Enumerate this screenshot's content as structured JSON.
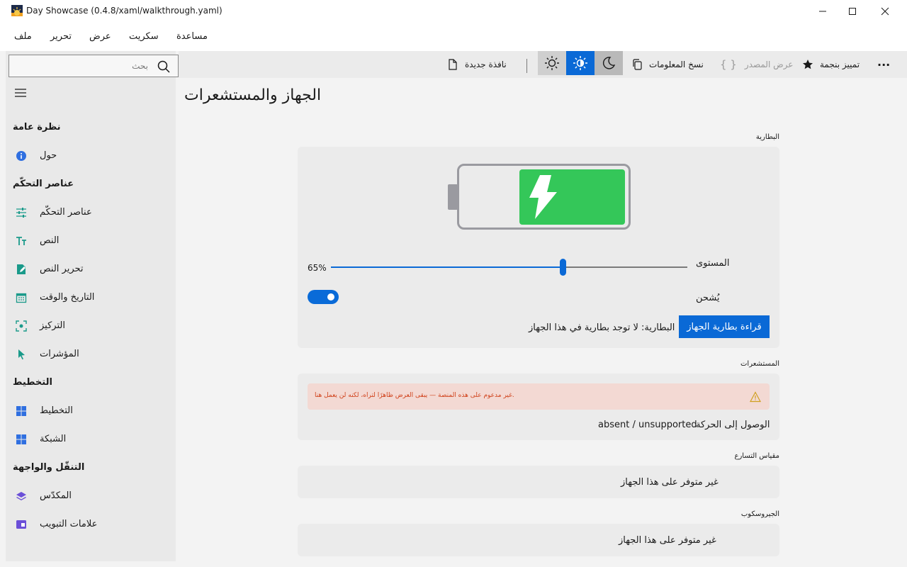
{
  "window": {
    "title": "Day Showcase (0.4.8/xaml/walkthrough.yaml)"
  },
  "menu": [
    "ملف",
    "تحرير",
    "عرض",
    "سكريت",
    "مساعدة"
  ],
  "toolbar": {
    "more": "···",
    "highlight_star": "تمييز بنجمة",
    "view_source": "عرض المصدر",
    "copy_info": "نسخ المعلومات",
    "new_window": "نافذة جديدة"
  },
  "search": {
    "placeholder": "بحث"
  },
  "sidebar": {
    "sections": [
      {
        "title": "نظرة عامة",
        "items": [
          {
            "label": "حول",
            "icon": "info-icon"
          }
        ]
      },
      {
        "title": "عناصر التحكّم",
        "items": [
          {
            "label": "عناصر التحكّم",
            "icon": "sliders-icon"
          },
          {
            "label": "النص",
            "icon": "text-icon"
          },
          {
            "label": "تحرير النص",
            "icon": "edit-icon"
          },
          {
            "label": "التاريخ والوقت",
            "icon": "calendar-icon"
          },
          {
            "label": "التركيز",
            "icon": "focus-icon"
          },
          {
            "label": "المؤشرات",
            "icon": "pointer-icon"
          }
        ]
      },
      {
        "title": "التخطيط",
        "items": [
          {
            "label": "التخطيط",
            "icon": "layout-icon"
          },
          {
            "label": "الشبكة",
            "icon": "grid-icon"
          }
        ]
      },
      {
        "title": "التنقّل والواجهة",
        "items": [
          {
            "label": "المكدّس",
            "icon": "stack-icon"
          },
          {
            "label": "علامات التبويب",
            "icon": "tabs-icon"
          }
        ]
      }
    ]
  },
  "page": {
    "title": "الجهاز والمستشعرات",
    "battery": {
      "section_label": "البطارية",
      "level_label": "المستوى",
      "level_value": "65%",
      "level_fraction": 0.65,
      "charging_label": "يُشحن",
      "charging_on": true,
      "read_button": "قراءة بطارية الجهاز",
      "status_text": "البطارية: لا توجد بطارية في هذا الجهاز"
    },
    "sensors": {
      "section_label": "المستشعرات",
      "warning": "غير مدعوم على هذه المنصة — يبقى العرض ظاهرًا لتراه، لكنه لن يعمل هنا.",
      "motion_label": "الوصول إلى الحركة",
      "motion_value": "absent / unsupported"
    },
    "accelerometer": {
      "section_label": "مقياس التسارع",
      "status": "غير متوفر على هذا الجهاز"
    },
    "gyroscope": {
      "section_label": "الجيروسكوب",
      "status": "غير متوفر على هذا الجهاز"
    }
  },
  "colors": {
    "accent": "#0a69d6",
    "battery_fill": "#34c759",
    "warning_bg": "#f3d9d3",
    "warning_text": "#d0421b"
  }
}
